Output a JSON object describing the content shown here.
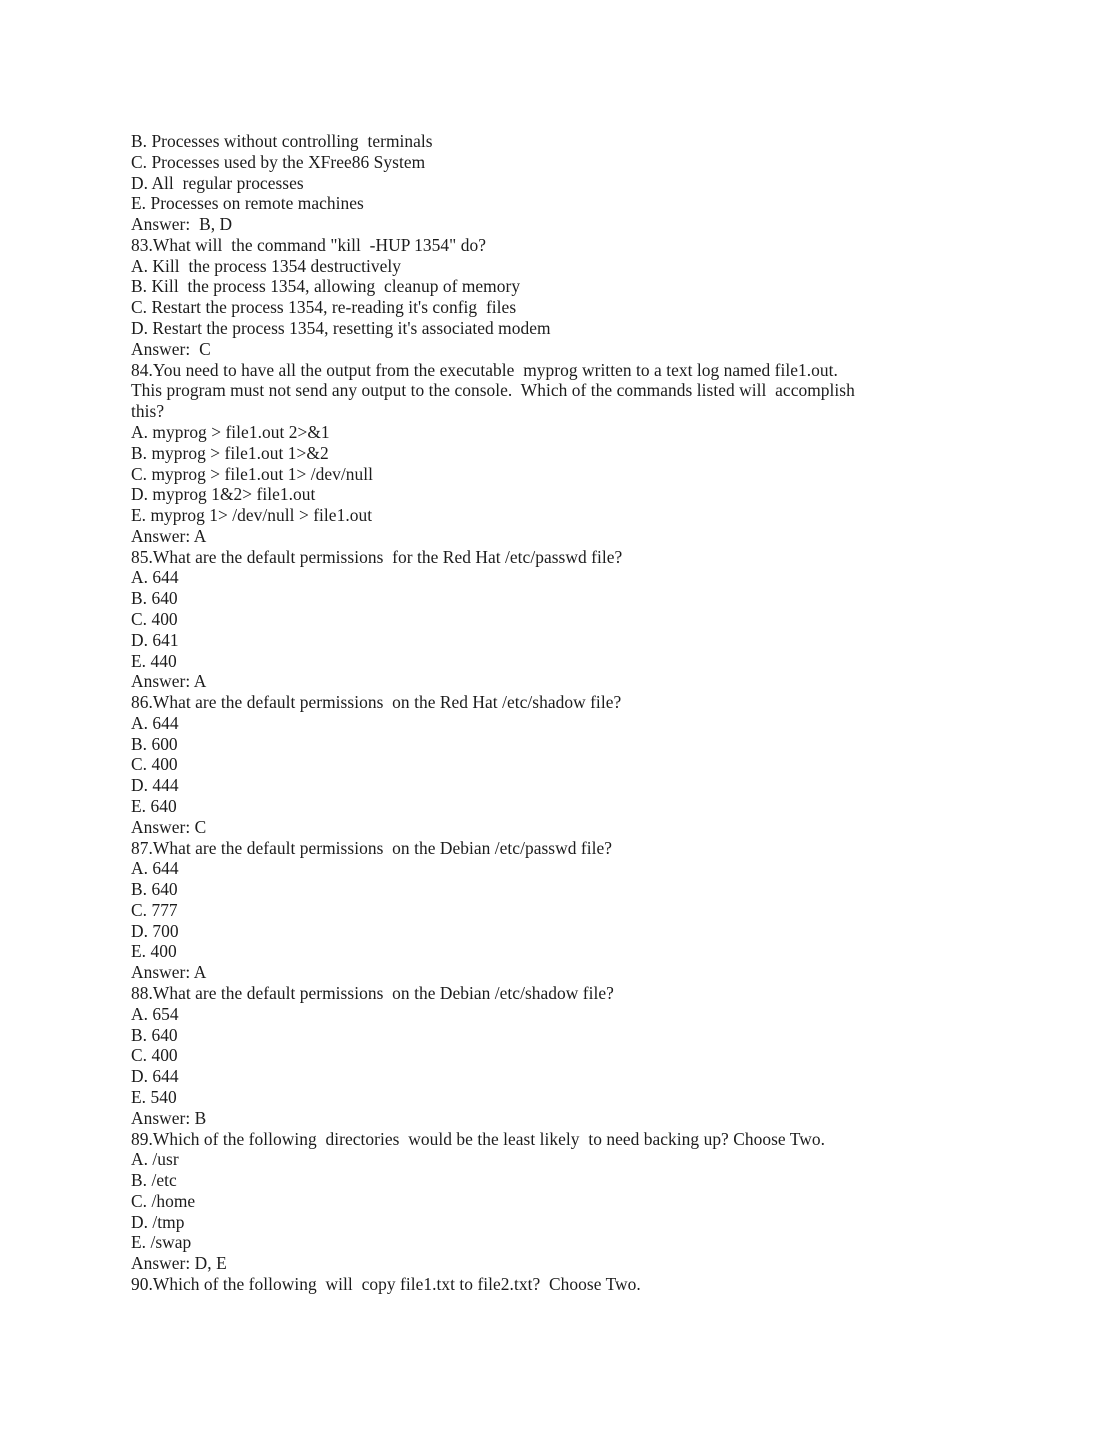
{
  "document": {
    "page_background": "#ffffff",
    "text_color": "#1c1c1c",
    "lines": [
      "B. Processes without controlling  terminals",
      "C. Processes used by the XFree86 System",
      "D. All  regular processes",
      "E. Processes on remote machines",
      "Answer:  B, D",
      "83.What will  the command \"kill  -HUP 1354\" do?",
      "A. Kill  the process 1354 destructively",
      "B. Kill  the process 1354, allowing  cleanup of memory",
      "C. Restart the process 1354, re-reading it's config  files",
      "D. Restart the process 1354, resetting it's associated modem",
      "Answer:  C",
      "84.You need to have all the output from the executable  myprog written to a text log named file1.out.",
      "This program must not send any output to the console.  Which of the commands listed will  accomplish",
      "this?",
      "A. myprog > file1.out 2>&1",
      "B. myprog > file1.out 1>&2",
      "C. myprog > file1.out 1> /dev/null",
      "D. myprog 1&2> file1.out",
      "E. myprog 1> /dev/null > file1.out",
      "Answer: A",
      "85.What are the default permissions  for the Red Hat /etc/passwd file?",
      "A. 644",
      "B. 640",
      "C. 400",
      "D. 641",
      "E. 440",
      "Answer: A",
      "86.What are the default permissions  on the Red Hat /etc/shadow file?",
      "A. 644",
      "B. 600",
      "C. 400",
      "D. 444",
      "E. 640",
      "Answer: C",
      "87.What are the default permissions  on the Debian /etc/passwd file?",
      "A. 644",
      "B. 640",
      "C. 777",
      "D. 700",
      "E. 400",
      "Answer: A",
      "88.What are the default permissions  on the Debian /etc/shadow file?",
      "A. 654",
      "B. 640",
      "C. 400",
      "D. 644",
      "E. 540",
      "Answer: B",
      "89.Which of the following  directories  would be the least likely  to need backing up? Choose Two.",
      "A. /usr",
      "B. /etc",
      "C. /home",
      "D. /tmp",
      "E. /swap",
      "Answer: D, E",
      "90.Which of the following  will  copy file1.txt to file2.txt?  Choose Two."
    ]
  }
}
